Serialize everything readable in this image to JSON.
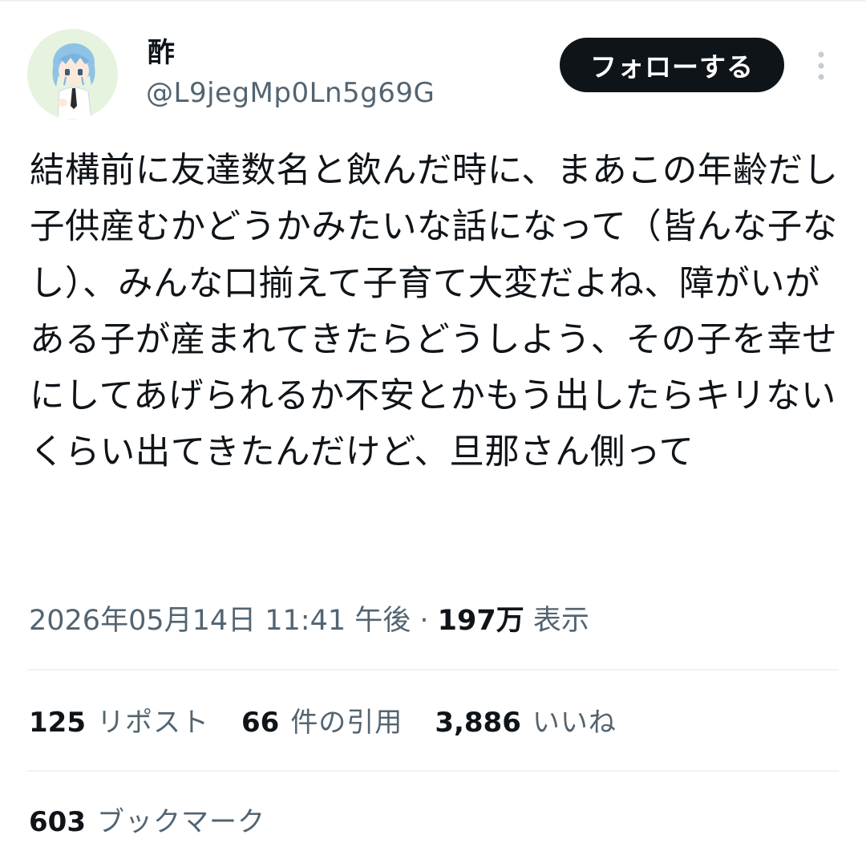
{
  "author": {
    "display_name": "酢",
    "handle": "@L9jegMp0Ln5g69G",
    "avatar_icon": "anime-character-avatar-icon"
  },
  "follow_button": {
    "label": "フォローする"
  },
  "more_button": {
    "icon": "more-vertical-icon"
  },
  "tweet": {
    "text": "結構前に友達数名と飲んだ時に、まあこの年齢だし子供産むかどうかみたいな話になって（皆んな子なし）、みんな口揃えて子育て大変だよね、障がいがある子が産まれてきたらどうしよう、その子を幸せにしてあげられるか不安とかもう出したらキリないくらい出てきたんだけど、旦那さん側って"
  },
  "meta": {
    "timestamp": "2026年05月14日 11:41 午後",
    "separator": " · ",
    "views_count": "197万",
    "views_label": "表示"
  },
  "stats": {
    "reposts": {
      "count": "125",
      "label": "リポスト"
    },
    "quotes": {
      "count": "66",
      "label": "件の引用"
    },
    "likes": {
      "count": "3,886",
      "label": "いいね"
    },
    "bookmarks": {
      "count": "603",
      "label": "ブックマーク"
    }
  },
  "colors": {
    "text_primary": "#0f1419",
    "text_secondary": "#536471",
    "divider": "#eff3f4",
    "button_bg": "#0f1419",
    "button_text": "#ffffff"
  }
}
